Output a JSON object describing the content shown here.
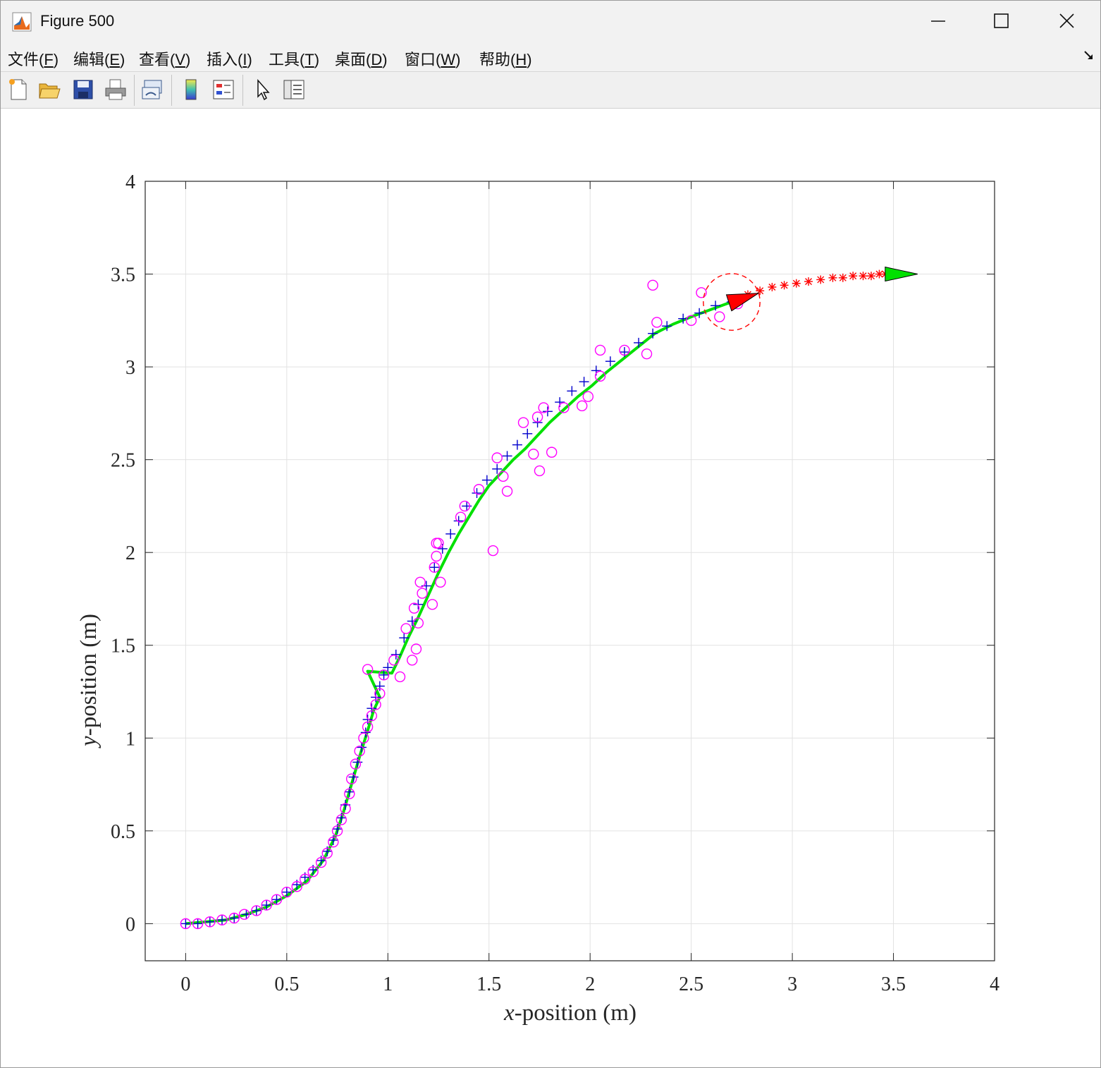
{
  "window": {
    "title": "Figure 500"
  },
  "menu": {
    "items": [
      {
        "pre": "文件(",
        "key": "F",
        "post": ")"
      },
      {
        "pre": "编辑(",
        "key": "E",
        "post": ")"
      },
      {
        "pre": "查看(",
        "key": "V",
        "post": ")"
      },
      {
        "pre": "插入(",
        "key": "I",
        "post": ")"
      },
      {
        "pre": "工具(",
        "key": "T",
        "post": ")"
      },
      {
        "pre": "桌面(",
        "key": "D",
        "post": ")"
      },
      {
        "pre": "窗口(",
        "key": "W",
        "post": ")"
      },
      {
        "pre": "帮助(",
        "key": "H",
        "post": ")"
      }
    ]
  },
  "toolbar": {
    "buttons": [
      "new-figure-icon",
      "open-folder-icon",
      "save-icon",
      "print-icon",
      "link-plot-icon",
      "colorbar-icon",
      "legend-icon",
      "pointer-icon",
      "property-inspector-icon"
    ]
  },
  "chart_data": {
    "type": "scatter",
    "title": "",
    "xlabel_var": "x",
    "xlabel_rest": "-position (m)",
    "ylabel_var": "y",
    "ylabel_rest": "-position (m)",
    "xlim": [
      -0.2,
      4
    ],
    "ylim": [
      -0.2,
      4
    ],
    "xticks": [
      0,
      0.5,
      1,
      1.5,
      2,
      2.5,
      3,
      3.5,
      4
    ],
    "yticks": [
      0,
      0.5,
      1,
      1.5,
      2,
      2.5,
      3,
      3.5,
      4
    ],
    "xtick_labels": [
      "0",
      "0.5",
      "1",
      "1.5",
      "2",
      "2.5",
      "3",
      "3.5",
      "4"
    ],
    "ytick_labels": [
      "0",
      "0.5",
      "1",
      "1.5",
      "2",
      "2.5",
      "3",
      "3.5",
      "4"
    ],
    "grid": true,
    "colors": {
      "measurement": "#ff00ff",
      "estimate": "#0000cc",
      "path": "#00e000",
      "prediction": "#ff0000",
      "current_marker": "#ff0000",
      "goal_marker": "#00e000"
    },
    "series": [
      {
        "marker": "plus",
        "color": "#0000cc",
        "x": [
          0,
          0.06,
          0.12,
          0.18,
          0.24,
          0.3,
          0.35,
          0.4,
          0.45,
          0.5,
          0.55,
          0.59,
          0.63,
          0.67,
          0.7,
          0.73,
          0.75,
          0.77,
          0.79,
          0.81,
          0.83,
          0.85,
          0.87,
          0.89,
          0.9,
          0.92,
          0.94,
          0.96,
          0.98,
          1,
          1.04,
          1.08,
          1.12,
          1.15,
          1.19,
          1.23,
          1.27,
          1.31,
          1.35,
          1.39,
          1.44,
          1.49,
          1.54,
          1.59,
          1.64,
          1.69,
          1.74,
          1.79,
          1.85,
          1.91,
          1.97,
          2.03,
          2.1,
          2.17,
          2.24,
          2.31,
          2.38,
          2.46,
          2.54,
          2.62,
          2.7
        ],
        "y": [
          0,
          0,
          0.01,
          0.02,
          0.03,
          0.05,
          0.07,
          0.1,
          0.13,
          0.17,
          0.21,
          0.25,
          0.29,
          0.34,
          0.39,
          0.45,
          0.51,
          0.57,
          0.64,
          0.71,
          0.79,
          0.87,
          0.95,
          1.03,
          1.1,
          1.16,
          1.22,
          1.28,
          1.34,
          1.38,
          1.45,
          1.54,
          1.63,
          1.72,
          1.82,
          1.92,
          2.02,
          2.1,
          2.17,
          2.25,
          2.32,
          2.39,
          2.45,
          2.52,
          2.58,
          2.64,
          2.7,
          2.76,
          2.81,
          2.87,
          2.92,
          2.98,
          3.03,
          3.08,
          3.13,
          3.18,
          3.22,
          3.26,
          3.29,
          3.33,
          3.35
        ]
      },
      {
        "marker": "circle",
        "color": "#ff00ff",
        "x": [
          0,
          0.06,
          0.12,
          0.18,
          0.24,
          0.29,
          0.35,
          0.4,
          0.45,
          0.5,
          0.55,
          0.59,
          0.63,
          0.67,
          0.7,
          0.73,
          0.75,
          0.77,
          0.79,
          0.81,
          0.82,
          0.84,
          0.86,
          0.88,
          0.9,
          0.92,
          0.94,
          0.96,
          0.98,
          0.9,
          1.03,
          1.06,
          1.09,
          1.12,
          1.13,
          1.14,
          1.15,
          1.16,
          1.17,
          1.22,
          1.23,
          1.24,
          1.25,
          1.26,
          1.24,
          1.36,
          1.38,
          1.45,
          1.52,
          1.54,
          1.57,
          1.59,
          1.67,
          1.72,
          1.74,
          1.75,
          1.77,
          1.81,
          1.87,
          1.96,
          1.99,
          2.05,
          2.05,
          2.17,
          2.28,
          2.31,
          2.33,
          2.5,
          2.55,
          2.64,
          2.73
        ],
        "y": [
          0,
          0,
          0.01,
          0.02,
          0.03,
          0.05,
          0.07,
          0.1,
          0.13,
          0.17,
          0.2,
          0.24,
          0.28,
          0.33,
          0.38,
          0.44,
          0.5,
          0.56,
          0.62,
          0.7,
          0.78,
          0.86,
          0.93,
          1,
          1.06,
          1.12,
          1.18,
          1.24,
          1.34,
          1.37,
          1.42,
          1.33,
          1.59,
          1.42,
          1.7,
          1.48,
          1.62,
          1.84,
          1.78,
          1.72,
          1.92,
          1.98,
          2.05,
          1.84,
          2.05,
          2.19,
          2.25,
          2.34,
          2.01,
          2.51,
          2.41,
          2.33,
          2.7,
          2.53,
          2.73,
          2.44,
          2.78,
          2.54,
          2.78,
          2.79,
          2.84,
          2.95,
          3.09,
          3.09,
          3.07,
          3.44,
          3.24,
          3.25,
          3.4,
          3.27,
          3.34
        ]
      },
      {
        "marker": "line",
        "color": "#00e000",
        "x": [
          0,
          0.1,
          0.2,
          0.3,
          0.4,
          0.5,
          0.6,
          0.68,
          0.74,
          0.78,
          0.82,
          0.86,
          0.9,
          0.93,
          0.96,
          0.9,
          1.02,
          1.06,
          1.1,
          1.15,
          1.2,
          1.25,
          1.3,
          1.35,
          1.4,
          1.45,
          1.5,
          1.56,
          1.62,
          1.68,
          1.74,
          1.8,
          1.87,
          1.94,
          2.01,
          2.08,
          2.16,
          2.24,
          2.32,
          2.41,
          2.5,
          2.6,
          2.7,
          2.74
        ],
        "y": [
          0,
          0.01,
          0.02,
          0.05,
          0.09,
          0.15,
          0.23,
          0.34,
          0.47,
          0.6,
          0.75,
          0.9,
          1.04,
          1.15,
          1.22,
          1.36,
          1.35,
          1.44,
          1.54,
          1.65,
          1.77,
          1.89,
          2,
          2.1,
          2.19,
          2.28,
          2.36,
          2.43,
          2.5,
          2.56,
          2.63,
          2.7,
          2.77,
          2.84,
          2.9,
          2.97,
          3.04,
          3.11,
          3.18,
          3.23,
          3.27,
          3.31,
          3.35,
          3.37
        ]
      },
      {
        "marker": "asterisk",
        "color": "#ff0000",
        "x": [
          2.72,
          2.78,
          2.84,
          2.9,
          2.96,
          3.02,
          3.08,
          3.14,
          3.2,
          3.25,
          3.3,
          3.35,
          3.39,
          3.43,
          3.46,
          3.48,
          3.49,
          3.5
        ],
        "y": [
          3.36,
          3.39,
          3.41,
          3.43,
          3.44,
          3.45,
          3.46,
          3.47,
          3.48,
          3.48,
          3.49,
          3.49,
          3.49,
          3.5,
          3.5,
          3.5,
          3.5,
          3.5
        ]
      }
    ],
    "current_pose": {
      "x": 2.7,
      "y": 3.35,
      "heading_deg": 18,
      "uncertainty_radius": 0.14
    },
    "goal_pose": {
      "x": 3.48,
      "y": 3.5,
      "heading_deg": 0
    }
  }
}
